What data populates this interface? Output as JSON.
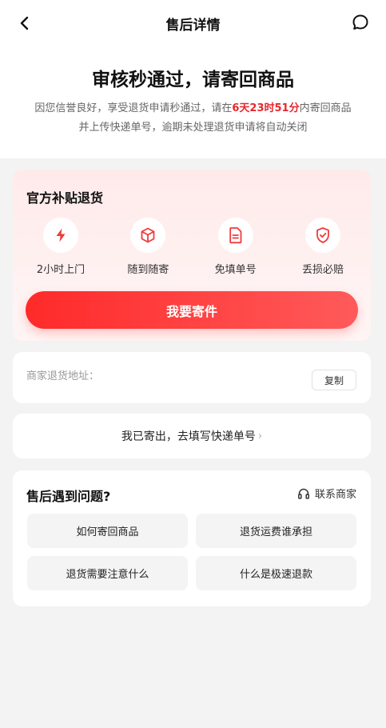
{
  "nav": {
    "title": "售后详情"
  },
  "status": {
    "title": "审核秒通过，请寄回商品",
    "desc_prefix": "因您信誉良好，享受退货申请秒通过，请在",
    "countdown": "6天23时51分",
    "desc_mid": "内寄回商品",
    "desc_line2": "并上传快递单号，逾期未处理退货申请将自动关闭"
  },
  "subsidy": {
    "title": "官方补贴退货",
    "features": [
      {
        "icon": "lightning-icon",
        "label": "2小时上门"
      },
      {
        "icon": "box-icon",
        "label": "随到随寄"
      },
      {
        "icon": "document-icon",
        "label": "免填单号"
      },
      {
        "icon": "shield-check-icon",
        "label": "丢损必赔"
      }
    ],
    "button": "我要寄件"
  },
  "address": {
    "label": "商家退货地址：",
    "copy": "复制"
  },
  "fill_tracking": {
    "label": "我已寄出，去填写快递单号",
    "arrow": "›"
  },
  "issues": {
    "title": "售后遇到问题?",
    "contact": "联系商家",
    "questions": [
      "如何寄回商品",
      "退货运费谁承担",
      "退货需要注意什么",
      "什么是极速退款"
    ]
  },
  "colors": {
    "accent": "#ff2a2a",
    "countdown": "#e8262d",
    "icon_red": "#f03a3a"
  }
}
